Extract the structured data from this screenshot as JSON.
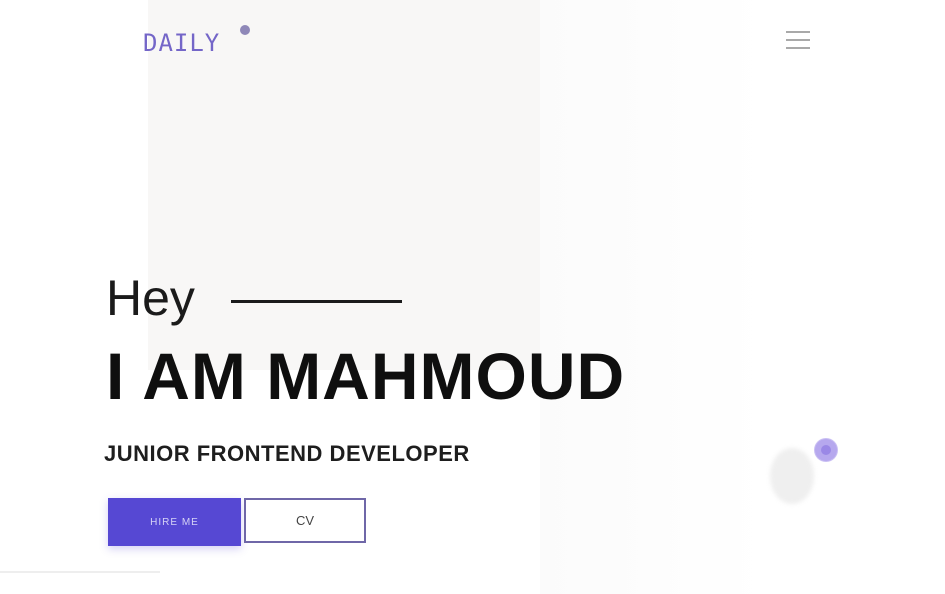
{
  "header": {
    "logo_text": "DAILY",
    "menu_icon": "hamburger-menu-icon"
  },
  "hero": {
    "greeting": "Hey",
    "name": "I AM MAHMOUD",
    "role": "JUNIOR FRONTEND DEVELOPER",
    "primary_button_label": "HIRE ME",
    "secondary_button_label": "CV"
  },
  "colors": {
    "accent": "#5648d3",
    "logo": "#7466c8",
    "text": "#0f0f0f",
    "decor_dot": "#9a88e6"
  }
}
